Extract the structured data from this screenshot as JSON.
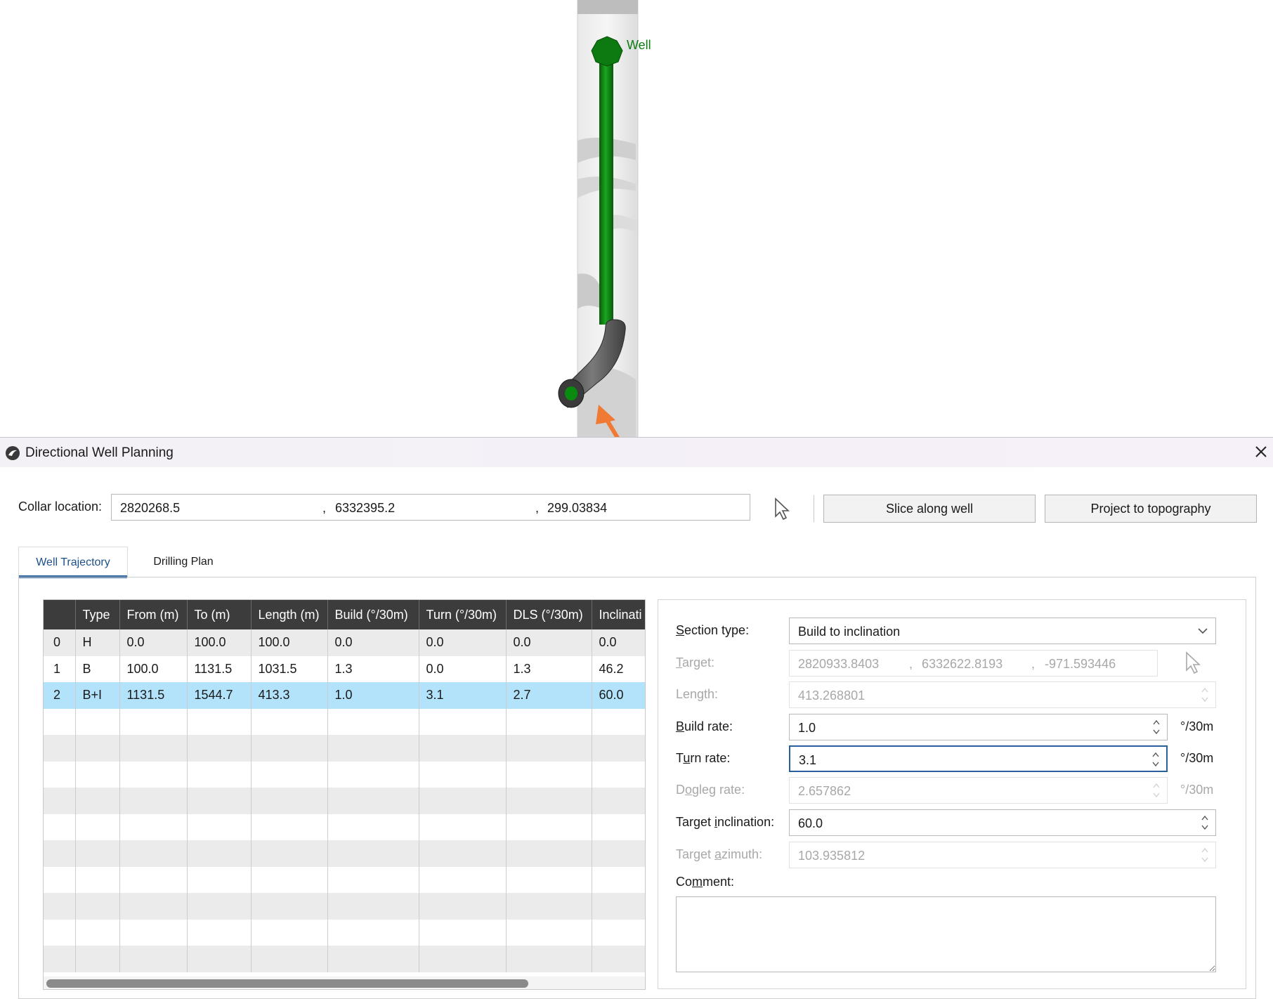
{
  "scene": {
    "well_label": "Well",
    "colors": {
      "well": "#0e7a12",
      "arrow": "#f07a33",
      "segment": "#555555"
    }
  },
  "dialog": {
    "title": "Directional Well Planning",
    "close_icon": "close-icon",
    "collar": {
      "label": "Collar location:",
      "x": "2820268.5",
      "y": "6332395.2",
      "z": "299.03834",
      "sep": ","
    },
    "buttons": {
      "slice": "Slice along well",
      "project": "Project to topography"
    },
    "tabs": [
      "Well Trajectory",
      "Drilling Plan"
    ],
    "table": {
      "columns": [
        "",
        "Type",
        "From (m)",
        "To (m)",
        "Length (m)",
        "Build (°/30m)",
        "Turn (°/30m)",
        "DLS (°/30m)",
        "Inclinati"
      ],
      "rows": [
        [
          "0",
          "H",
          "0.0",
          "100.0",
          "100.0",
          "0.0",
          "0.0",
          "0.0",
          "0.0"
        ],
        [
          "1",
          "B",
          "100.0",
          "1131.5",
          "1031.5",
          "1.3",
          "0.0",
          "1.3",
          "46.2"
        ],
        [
          "2",
          "B+I",
          "1131.5",
          "1544.7",
          "413.3",
          "1.0",
          "3.1",
          "2.7",
          "60.0"
        ]
      ],
      "selected_row": 2
    },
    "form": {
      "section_type_label": "Section type:",
      "section_type_value": "Build to inclination",
      "target_label": "Target:",
      "target_x": "2820933.8403",
      "target_y": "6332622.8193",
      "target_z": "-971.593446",
      "length_label": "Length:",
      "length_value": "413.268801",
      "build_rate_label": "Build rate:",
      "build_rate_value": "1.0",
      "turn_rate_label": "Turn rate:",
      "turn_rate_value": "3.1",
      "dogleg_rate_label": "Dogleg rate:",
      "dogleg_rate_value": "2.657862",
      "unit": "°/30m",
      "target_inclination_label": "Target inclination:",
      "target_inclination_value": "60.0",
      "target_azimuth_label": "Target azimuth:",
      "target_azimuth_value": "103.935812",
      "comment_label": "Comment:",
      "comment_value": ""
    }
  }
}
